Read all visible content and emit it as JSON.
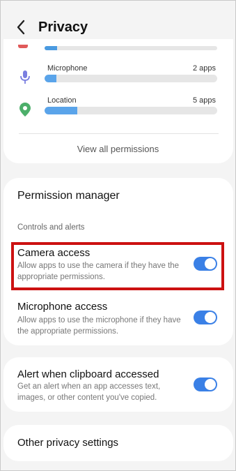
{
  "header": {
    "title": "Privacy",
    "back_icon": "chevron-left-icon"
  },
  "usage": {
    "items": [
      {
        "label": "Microphone",
        "count": "2 apps",
        "fill_fraction": 0.07,
        "icon": "microphone-icon",
        "color": "#7b7fe0"
      },
      {
        "label": "Location",
        "count": "5 apps",
        "fill_fraction": 0.19,
        "icon": "location-pin-icon",
        "color": "#4caf6a"
      }
    ],
    "bar_color": "#5aa4ea",
    "view_all_label": "View all permissions"
  },
  "permission_manager": {
    "label": "Permission manager"
  },
  "controls": {
    "section_label": "Controls and alerts",
    "camera": {
      "title": "Camera access",
      "description": "Allow apps to use the camera if they have the appropriate permissions.",
      "enabled": true
    },
    "microphone": {
      "title": "Microphone access",
      "description": "Allow apps to use the microphone if they have the appropriate permissions.",
      "enabled": true
    }
  },
  "clipboard": {
    "title": "Alert when clipboard accessed",
    "description": "Get an alert when an app accesses text, images, or other content you've copied.",
    "enabled": true
  },
  "other": {
    "label": "Other privacy settings"
  },
  "colors": {
    "toggle_on": "#3a80e6",
    "highlight": "#cc1111",
    "background": "#f4f4f4"
  }
}
